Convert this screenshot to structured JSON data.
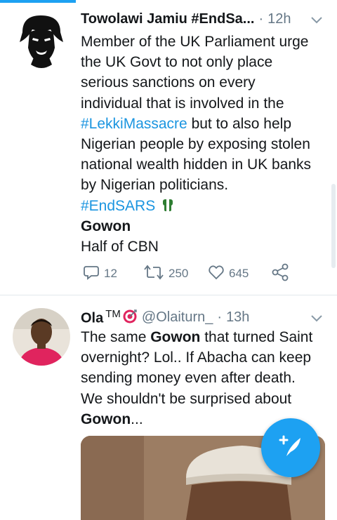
{
  "tweets": [
    {
      "display_name": "Towolawi Jamiu #EndSa...",
      "time": "12h",
      "body_lines": [
        "Member of the UK Parliament urge",
        "the UK Govt to not only place",
        "serious sanctions on every",
        "individual that is involved in the"
      ],
      "hashtag1": "#LekkiMassacre",
      "hashtag1_tail": " but to also help",
      "body_lines_2": [
        "Nigerian people by exposing stolen",
        "national wealth hidden in UK banks",
        "by Nigerian politicians."
      ],
      "hashtag2": "#EndSARS",
      "bold_line": "Gowon",
      "last_line": "Half of CBN",
      "actions": {
        "replies": "12",
        "retweets": "250",
        "likes": "645"
      }
    },
    {
      "display_name": "Ola",
      "tm": "TM",
      "handle": "@Olaiturn_",
      "time": "13h",
      "line1_pre": "The same ",
      "line1_bold": "Gowon",
      "line1_post": " that turned Saint",
      "line2": "overnight? Lol.. If Abacha can keep",
      "line3": "sending money even after death.",
      "line4": "We shouldn't be surprised about",
      "line5_bold": "Gowon",
      "line5_post": "..."
    }
  ],
  "icons": {
    "reply": "reply-icon",
    "retweet": "retweet-icon",
    "like": "like-icon",
    "share": "share-icon",
    "compose": "compose-tweet-icon",
    "chevron": "chevron-down-icon"
  },
  "colors": {
    "accent": "#1da1f2",
    "link": "#1b95e0",
    "muted": "#657786"
  }
}
